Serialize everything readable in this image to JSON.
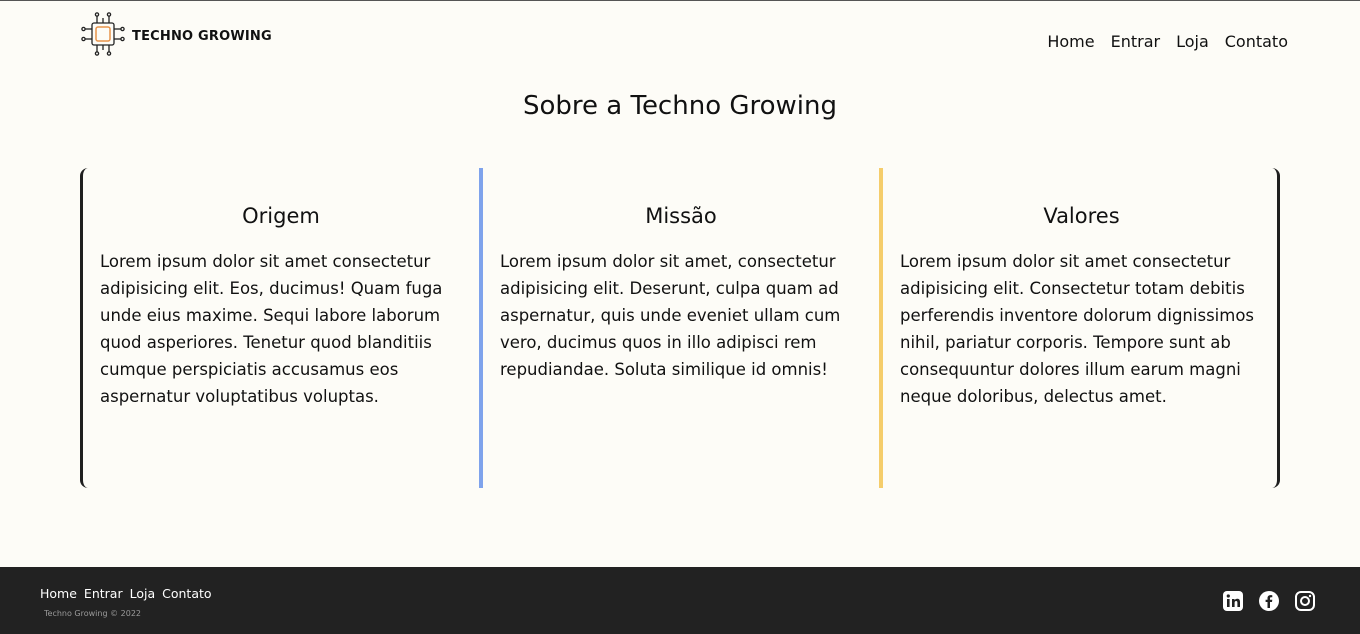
{
  "header": {
    "logo_text": "TECHNO GROWING",
    "nav": [
      "Home",
      "Entrar",
      "Loja",
      "Contato"
    ]
  },
  "main": {
    "title": "Sobre a Techno Growing",
    "cards": [
      {
        "title": "Origem",
        "text": "Lorem ipsum dolor sit amet consectetur adipisicing elit. Eos, ducimus! Quam fuga unde eius maxime. Sequi labore laborum quod asperiores. Tenetur quod blanditiis cumque perspiciatis accusamus eos aspernatur voluptatibus voluptas."
      },
      {
        "title": "Missão",
        "text": "Lorem ipsum dolor sit amet, consectetur adipisicing elit. Deserunt, culpa quam ad aspernatur, quis unde eveniet ullam cum vero, ducimus quos in illo adipisci rem repudiandae. Soluta similique id omnis!"
      },
      {
        "title": "Valores",
        "text": "Lorem ipsum dolor sit amet consectetur adipisicing elit. Consectetur totam debitis perferendis inventore dolorum dignissimos nihil, pariatur corporis. Tempore sunt ab consequuntur dolores illum earum magni neque doloribus, delectus amet."
      }
    ]
  },
  "footer": {
    "nav": [
      "Home",
      "Entrar",
      "Loja",
      "Contato"
    ],
    "copyright": "Techno Growing © 2022",
    "social_icons": [
      "linkedin-icon",
      "facebook-icon",
      "instagram-icon"
    ]
  },
  "colors": {
    "background": "#fdfcf7",
    "accent_blue": "#7fa3ec",
    "accent_yellow": "#f5cd6b",
    "accent_orange": "#e8934a",
    "footer_bg": "#222222"
  }
}
